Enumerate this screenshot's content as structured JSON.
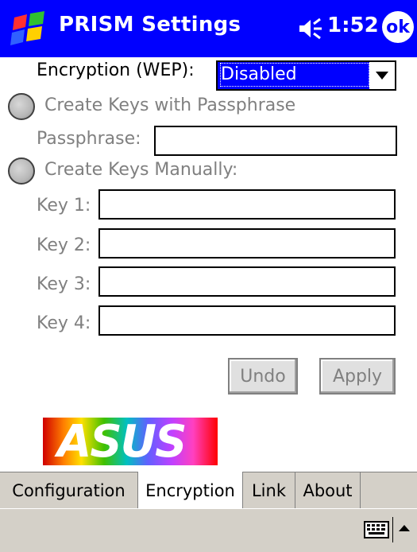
{
  "titlebar": {
    "app_title": "PRISM Settings",
    "clock": "1:52",
    "ok_label": "ok"
  },
  "encryption": {
    "label": "Encryption (WEP):",
    "selected": "Disabled"
  },
  "passphrase_option": {
    "radio_label": "Create Keys with Passphrase",
    "field_label": "Passphrase:",
    "value": ""
  },
  "manual_option": {
    "radio_label": "Create Keys Manually:",
    "keys": [
      {
        "label": "Key 1:",
        "value": ""
      },
      {
        "label": "Key 2:",
        "value": ""
      },
      {
        "label": "Key 3:",
        "value": ""
      },
      {
        "label": "Key 4:",
        "value": ""
      }
    ]
  },
  "buttons": {
    "undo": "Undo",
    "apply": "Apply"
  },
  "logo_text": "ASUS",
  "tabs": [
    {
      "label": "Configuration",
      "active": false
    },
    {
      "label": "Encryption",
      "active": true
    },
    {
      "label": "Link",
      "active": false
    },
    {
      "label": "About",
      "active": false
    }
  ],
  "colors": {
    "titlebar": "#0000ff",
    "disabled_text": "#808080",
    "tab_background": "#d4d0c8"
  }
}
